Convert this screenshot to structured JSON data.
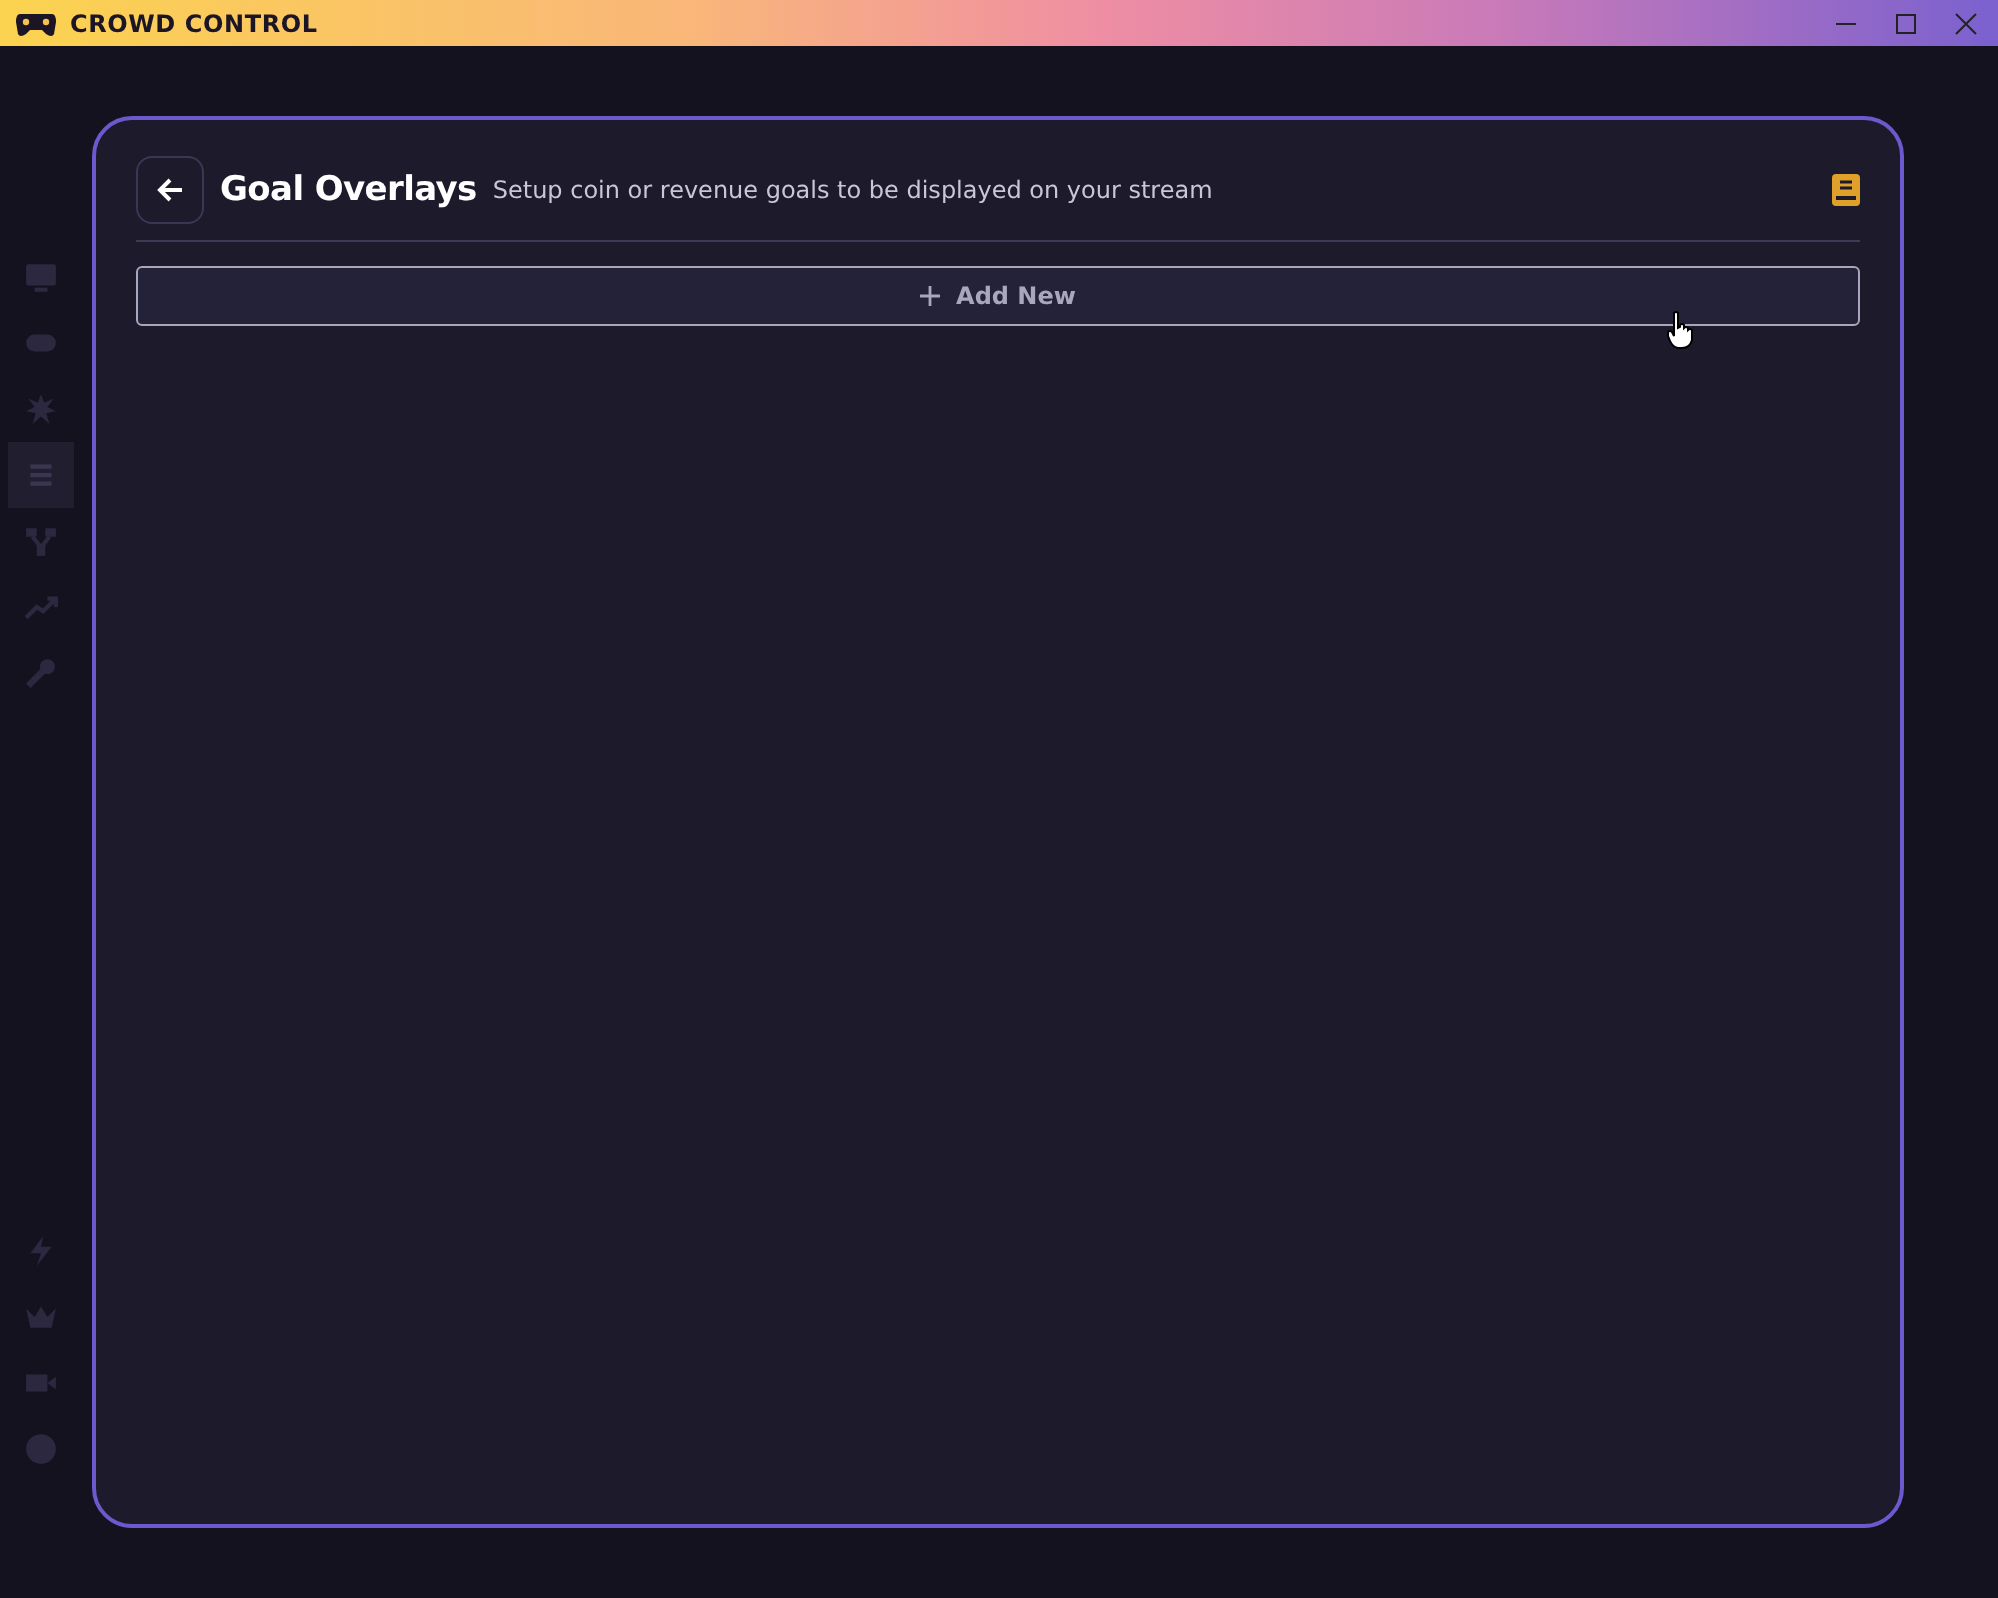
{
  "window": {
    "title": "CROWD CONTROL"
  },
  "modal": {
    "title": "Goal Overlays",
    "subtitle": "Setup coin or revenue goals to be displayed on your stream",
    "add_button": {
      "label": "Add New"
    }
  }
}
